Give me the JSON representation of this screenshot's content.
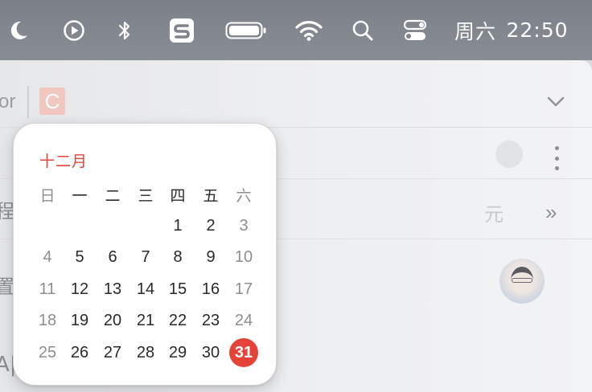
{
  "menubar": {
    "icons": [
      "moon-icon",
      "play-circle-icon",
      "bluetooth-icon",
      "sogou-input-icon",
      "battery-icon",
      "wifi-icon",
      "search-icon",
      "control-center-icon"
    ],
    "weekday": "周六",
    "time": "22:50"
  },
  "app": {
    "header_text": "or",
    "badge_letter": "C",
    "side_labels": [
      "程",
      "置",
      "A|"
    ],
    "ghost_unit": "元"
  },
  "calendar": {
    "month": "十二月",
    "weekday_headers": [
      "日",
      "一",
      "二",
      "三",
      "四",
      "五",
      "六"
    ],
    "weeks": [
      [
        "",
        "",
        "",
        "",
        "1",
        "2",
        "3"
      ],
      [
        "4",
        "5",
        "6",
        "7",
        "8",
        "9",
        "10"
      ],
      [
        "11",
        "12",
        "13",
        "14",
        "15",
        "16",
        "17"
      ],
      [
        "18",
        "19",
        "20",
        "21",
        "22",
        "23",
        "24"
      ],
      [
        "25",
        "26",
        "27",
        "28",
        "29",
        "30",
        "31"
      ]
    ],
    "today": "31",
    "colors": {
      "accent": "#e64338",
      "weekend": "#8e8e93",
      "weekday": "#2a2a2c"
    }
  }
}
